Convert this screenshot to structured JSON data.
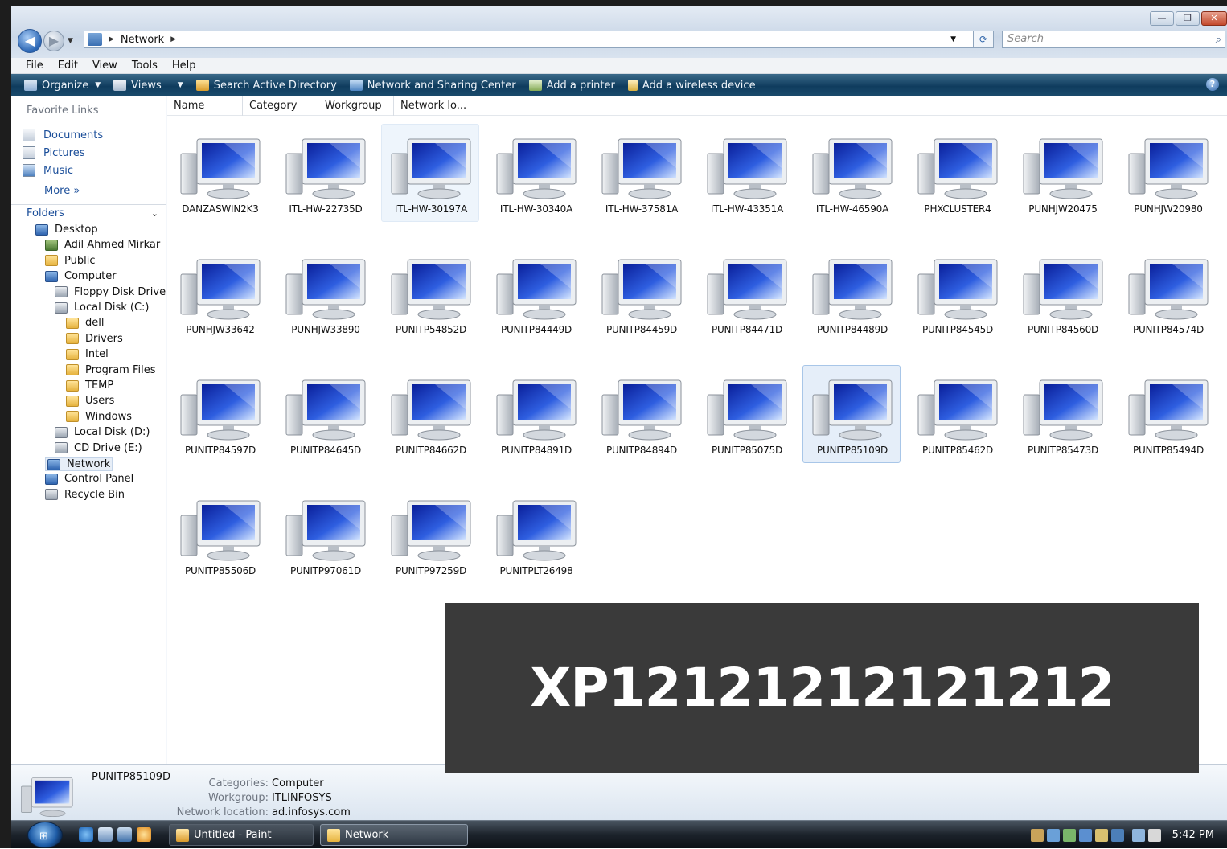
{
  "window": {
    "controls": {
      "minimize": "—",
      "maximize": "❐",
      "close": "✕"
    }
  },
  "address": {
    "path": "Network",
    "search_placeholder": "Search",
    "back_glyph": "◀",
    "forward_glyph": "▶",
    "refresh_glyph": "⟳",
    "search_glyph": "⌕"
  },
  "menu": [
    "File",
    "Edit",
    "View",
    "Tools",
    "Help"
  ],
  "toolbar": {
    "organize": "Organize",
    "views": "Views",
    "search_ad": "Search Active Directory",
    "network_sharing": "Network and Sharing Center",
    "add_printer": "Add a printer",
    "add_wireless": "Add a wireless device",
    "help": "?"
  },
  "left": {
    "favorite_links_title": "Favorite Links",
    "favorites": [
      "Documents",
      "Pictures",
      "Music"
    ],
    "more": "More  »",
    "folders_title": "Folders",
    "tree": [
      {
        "label": "Desktop",
        "icon": "blue",
        "level": 0
      },
      {
        "label": "Adil Ahmed Mirkar",
        "icon": "user",
        "level": 1
      },
      {
        "label": "Public",
        "icon": "folder",
        "level": 1
      },
      {
        "label": "Computer",
        "icon": "blue",
        "level": 1
      },
      {
        "label": "Floppy Disk Drive",
        "icon": "drive",
        "level": 2
      },
      {
        "label": "Local Disk (C:)",
        "icon": "drive",
        "level": 2
      },
      {
        "label": "dell",
        "icon": "folder",
        "level": 3
      },
      {
        "label": "Drivers",
        "icon": "folder",
        "level": 3
      },
      {
        "label": "Intel",
        "icon": "folder",
        "level": 3
      },
      {
        "label": "Program Files",
        "icon": "folder",
        "level": 3
      },
      {
        "label": "TEMP",
        "icon": "folder",
        "level": 3
      },
      {
        "label": "Users",
        "icon": "folder",
        "level": 3
      },
      {
        "label": "Windows",
        "icon": "folder",
        "level": 3
      },
      {
        "label": "Local Disk (D:)",
        "icon": "drive",
        "level": 2
      },
      {
        "label": "CD Drive (E:)",
        "icon": "drive",
        "level": 2
      },
      {
        "label": "Network",
        "icon": "blue",
        "level": 1,
        "selected": true
      },
      {
        "label": "Control Panel",
        "icon": "blue",
        "level": 1
      },
      {
        "label": "Recycle Bin",
        "icon": "drive",
        "level": 1
      }
    ]
  },
  "columns": [
    "Name",
    "Category",
    "Workgroup",
    "Network lo..."
  ],
  "computers": [
    "DANZASWIN2K3",
    "ITL-HW-22735D",
    "ITL-HW-30197A",
    "ITL-HW-30340A",
    "ITL-HW-37581A",
    "ITL-HW-43351A",
    "ITL-HW-46590A",
    "PHXCLUSTER4",
    "PUNHJW20475",
    "PUNHJW20980",
    "PUNHJW33642",
    "PUNHJW33890",
    "PUNITP54852D",
    "PUNITP84449D",
    "PUNITP84459D",
    "PUNITP84471D",
    "PUNITP84489D",
    "PUNITP84545D",
    "PUNITP84560D",
    "PUNITP84574D",
    "PUNITP84597D",
    "PUNITP84645D",
    "PUNITP84662D",
    "PUNITP84891D",
    "PUNITP84894D",
    "PUNITP85075D",
    "PUNITP85109D",
    "PUNITP85462D",
    "PUNITP85473D",
    "PUNITP85494D",
    "PUNITP85506D",
    "PUNITP97061D",
    "PUNITP97259D",
    "PUNITPLT26498"
  ],
  "selected_index": 26,
  "hover_index": 2,
  "overlay_text": "XP12121212121212",
  "details": {
    "name": "PUNITP85109D",
    "rows": [
      {
        "key": "Categories:",
        "value": "Computer"
      },
      {
        "key": "Workgroup:",
        "value": "ITLINFOSYS"
      },
      {
        "key": "Network location:",
        "value": "ad.infosys.com"
      }
    ]
  },
  "taskbar": {
    "tasks": [
      "Untitled - Paint",
      "Network"
    ],
    "clock": "5:42 PM",
    "start_glyph": "⊞"
  },
  "colors": {
    "toolbar": "#0f3c5e",
    "link": "#1c4f9a",
    "overlay": "#3a3a3a"
  }
}
